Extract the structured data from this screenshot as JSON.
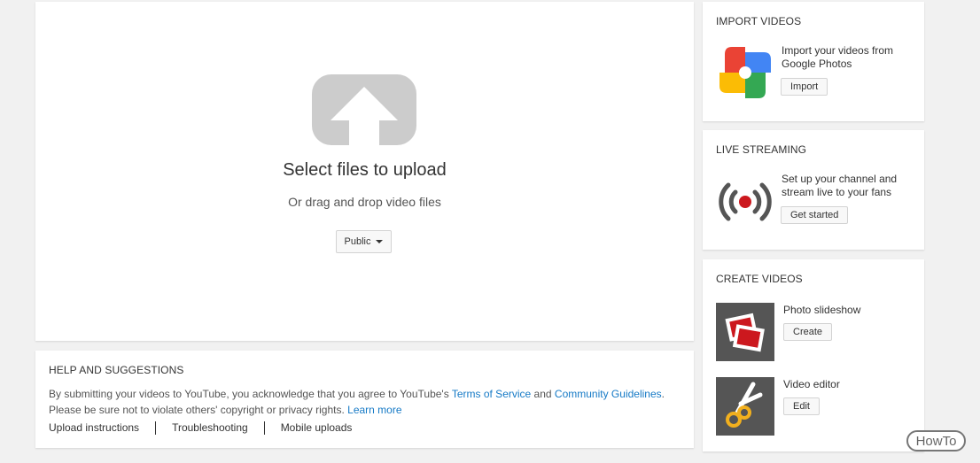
{
  "upload": {
    "title": "Select files to upload",
    "subtitle": "Or drag and drop video files",
    "privacy_label": "Public",
    "icon": "upload-arrow-icon"
  },
  "help": {
    "title": "HELP AND SUGGESTIONS",
    "text_before_tos": "By submitting your videos to YouTube, you acknowledge that you agree to YouTube's",
    "tos_link": "Terms of Service",
    "and_text": "and",
    "guidelines_link": "Community Guidelines",
    "line2_text": "Please be sure not to violate others' copyright or privacy rights.",
    "learn_more": "Learn more",
    "links": [
      "Upload instructions",
      "Troubleshooting",
      "Mobile uploads"
    ]
  },
  "import": {
    "title": "IMPORT VIDEOS",
    "description": "Import your videos from Google Photos",
    "button": "Import",
    "icon": "google-photos-icon"
  },
  "live": {
    "title": "LIVE STREAMING",
    "description": "Set up your channel and stream live to your fans",
    "button": "Get started",
    "icon": "live-broadcast-icon",
    "accent": "#cc181e"
  },
  "create": {
    "title": "CREATE VIDEOS",
    "items": [
      {
        "label": "Photo slideshow",
        "button": "Create",
        "icon": "photos-icon"
      },
      {
        "label": "Video editor",
        "button": "Edit",
        "icon": "scissors-icon"
      }
    ]
  },
  "watermark": "HowTo"
}
